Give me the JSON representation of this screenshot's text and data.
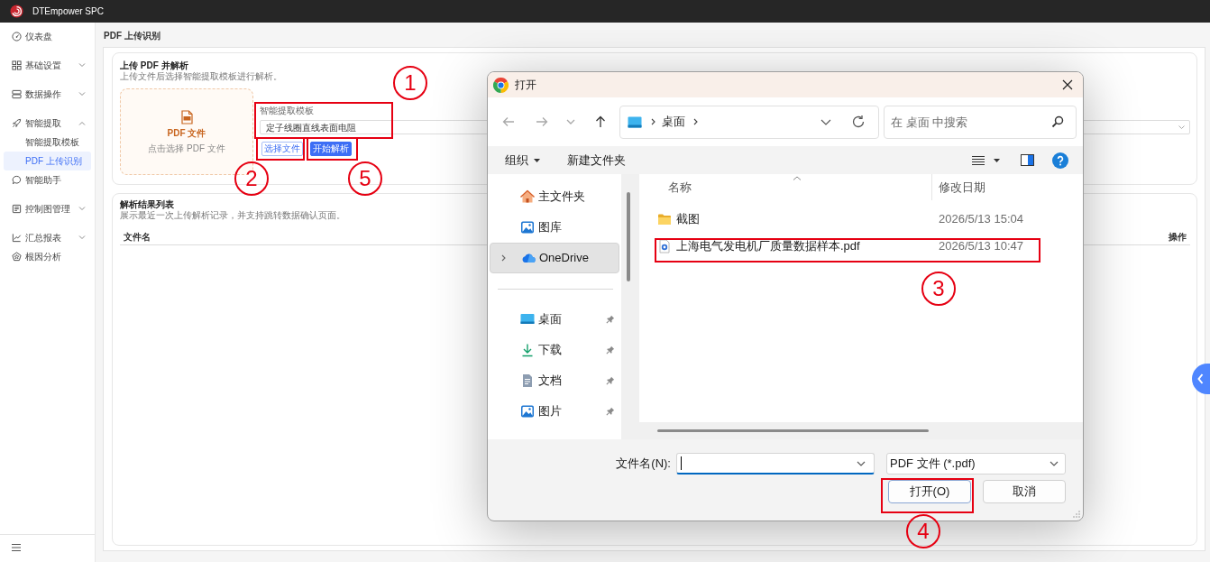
{
  "app": {
    "title": "DTEmpower SPC"
  },
  "sidebar": {
    "items": [
      {
        "label": "仪表盘",
        "kind": "link",
        "selected": false
      },
      {
        "label": "基础设置",
        "kind": "group",
        "selected": false,
        "expanded": false
      },
      {
        "label": "数据操作",
        "kind": "group",
        "selected": false,
        "expanded": false
      },
      {
        "label": "智能提取",
        "kind": "group",
        "selected": false,
        "expanded": true,
        "children": [
          {
            "label": "智能提取模板",
            "selected": false
          },
          {
            "label": "PDF 上传识别",
            "selected": true
          }
        ]
      },
      {
        "label": "智能助手",
        "kind": "link",
        "selected": false
      },
      {
        "label": "控制图管理",
        "kind": "group",
        "selected": false,
        "expanded": false
      },
      {
        "label": "汇总报表",
        "kind": "group",
        "selected": false,
        "expanded": false
      },
      {
        "label": "根因分析",
        "kind": "link",
        "selected": false
      }
    ]
  },
  "page": {
    "title": "PDF 上传识别"
  },
  "upload_card": {
    "title": "上传 PDF 并解析",
    "subtitle": "上传文件后选择智能提取模板进行解析。",
    "dropzone": {
      "title": "PDF 文件",
      "hint": "点击选择 PDF 文件"
    },
    "template": {
      "label": "智能提取模板",
      "value": "定子线圈直线表面电阻"
    },
    "buttons": [
      {
        "label": "选择文件",
        "kind": "secondary"
      },
      {
        "label": "开始解析",
        "kind": "primary"
      }
    ]
  },
  "results_card": {
    "title": "解析结果列表",
    "subtitle": "展示最近一次上传解析记录，并支持跳转数据确认页面。",
    "columns": [
      "文件名",
      "操作"
    ]
  },
  "dialog": {
    "title": "打开",
    "navigation": [
      {
        "kind": "back",
        "disabled": true
      },
      {
        "kind": "forward",
        "disabled": true
      },
      {
        "kind": "recent",
        "disabled": true
      },
      {
        "kind": "up",
        "disabled": false
      }
    ],
    "breadcrumb": [
      "桌面"
    ],
    "search": {
      "placeholder": "在 桌面 中搜索"
    },
    "toolbar": [
      {
        "label": "组织",
        "kind": "menu"
      },
      {
        "label": "新建文件夹",
        "kind": "action"
      }
    ],
    "nav_pane": {
      "sections": [
        {
          "items": [
            {
              "label": "主文件夹",
              "kind": "home",
              "selected": false,
              "pinned": false
            },
            {
              "label": "图库",
              "kind": "gallery",
              "selected": false,
              "pinned": false
            },
            {
              "label": "OneDrive",
              "kind": "cloud",
              "selected": true,
              "pinned": false
            }
          ]
        },
        {
          "items": [
            {
              "label": "桌面",
              "kind": "desktop",
              "selected": false,
              "pinned": true
            },
            {
              "label": "下载",
              "kind": "downloads",
              "selected": false,
              "pinned": true
            },
            {
              "label": "文档",
              "kind": "documents",
              "selected": false,
              "pinned": true
            },
            {
              "label": "图片",
              "kind": "pictures",
              "selected": false,
              "pinned": true
            }
          ]
        }
      ]
    },
    "columns": [
      {
        "label": "名称",
        "sorted": true
      },
      {
        "label": "修改日期",
        "sorted": false
      }
    ],
    "files": [
      {
        "name": "截图",
        "kind": "folder",
        "modified": "2026/5/13 15:04"
      },
      {
        "name": "上海电气发电机厂质量数据样本.pdf",
        "kind": "pdf",
        "modified": "2026/5/13 10:47"
      }
    ],
    "file_name": {
      "label": "文件名(N):",
      "focused": true
    },
    "file_type": {
      "value": "PDF 文件 (*.pdf)"
    },
    "buttons": [
      {
        "label": "打开(O)",
        "kind": "default"
      },
      {
        "label": "取消",
        "kind": "normal"
      }
    ]
  },
  "annotations": [
    {
      "label": "1"
    },
    {
      "label": "2"
    },
    {
      "label": "3"
    },
    {
      "label": "4"
    },
    {
      "label": "5"
    }
  ]
}
